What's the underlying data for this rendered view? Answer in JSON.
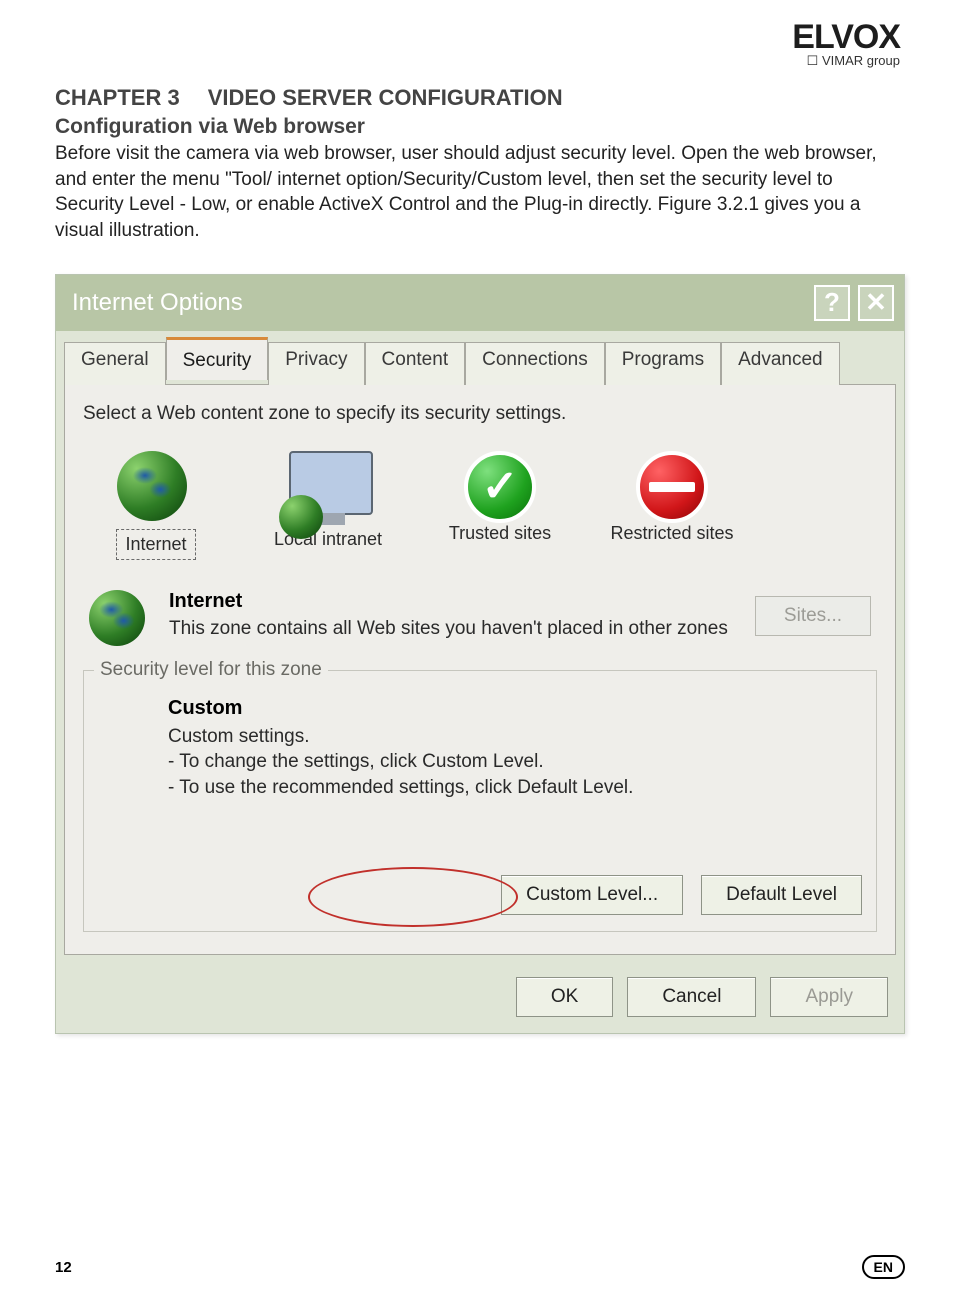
{
  "brand": {
    "name": "ELVOX",
    "group": "VIMAR group"
  },
  "chapter": {
    "label": "CHAPTER 3",
    "title": "VIDEO SERVER CONFIGURATION"
  },
  "subheading": "Configuration via Web browser",
  "paragraph": "Before visit the camera via web browser, user should adjust security level. Open the web browser, and enter the menu \"Tool/ internet option/Security/Custom level, then set the security level to Security Level - Low, or enable ActiveX Control and the Plug-in directly. Figure 3.2.1 gives you a visual illustration.",
  "dialog": {
    "title": "Internet Options",
    "help_label": "?",
    "close_label": "✕",
    "tabs": [
      "General",
      "Security",
      "Privacy",
      "Content",
      "Connections",
      "Programs",
      "Advanced"
    ],
    "active_tab": 1,
    "zone_prompt": "Select a Web content zone to specify its security settings.",
    "zones": [
      {
        "label": "Internet"
      },
      {
        "label": "Local intranet"
      },
      {
        "label": "Trusted sites"
      },
      {
        "label": "Restricted sites"
      }
    ],
    "zone_detail": {
      "heading": "Internet",
      "desc": "This zone contains all Web sites you haven't placed in other zones",
      "sites_button": "Sites..."
    },
    "security_frame": {
      "legend": "Security level for this zone",
      "heading": "Custom",
      "line1": "Custom settings.",
      "line2": "- To change the settings, click Custom Level.",
      "line3": "- To use the recommended settings, click Default Level.",
      "custom_button": "Custom Level...",
      "default_button": "Default Level"
    },
    "footer_buttons": {
      "ok": "OK",
      "cancel": "Cancel",
      "apply": "Apply"
    }
  },
  "page_footer": {
    "page_number": "12",
    "lang": "EN"
  }
}
